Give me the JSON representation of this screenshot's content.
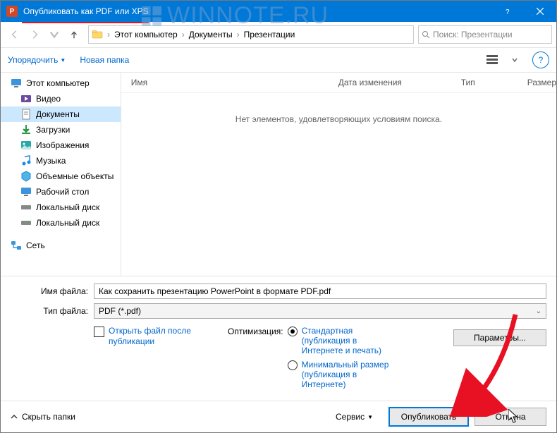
{
  "title": "Опубликовать как PDF или XPS",
  "watermark": "WINNOTE.RU",
  "breadcrumbs": [
    "Этот компьютер",
    "Документы",
    "Презентации"
  ],
  "search_placeholder": "Поиск: Презентации",
  "toolbar": {
    "organize": "Упорядочить",
    "newfolder": "Новая папка"
  },
  "columns": {
    "name": "Имя",
    "date": "Дата изменения",
    "type": "Тип",
    "size": "Размер"
  },
  "empty": "Нет элементов, удовлетворяющих условиям поиска.",
  "sidebar": {
    "root": "Этот компьютер",
    "items": [
      "Видео",
      "Документы",
      "Загрузки",
      "Изображения",
      "Музыка",
      "Объемные объекты",
      "Рабочий стол",
      "Локальный диск",
      "Локальный диск"
    ],
    "network": "Сеть"
  },
  "labels": {
    "filename": "Имя файла:",
    "filetype": "Тип файла:"
  },
  "filename": "Как сохранить презентацию PowerPoint в формате PDF.pdf",
  "filetype": "PDF (*.pdf)",
  "openafter": "Открыть файл после публикации",
  "optimization": "Оптимизация:",
  "opt_standard": "Стандартная (публикация в Интернете и печать)",
  "opt_min": "Минимальный размер (публикация в Интернете)",
  "params": "Параметры...",
  "hide": "Скрыть папки",
  "service": "Сервис",
  "publish": "Опубликовать",
  "cancel": "Отмена"
}
